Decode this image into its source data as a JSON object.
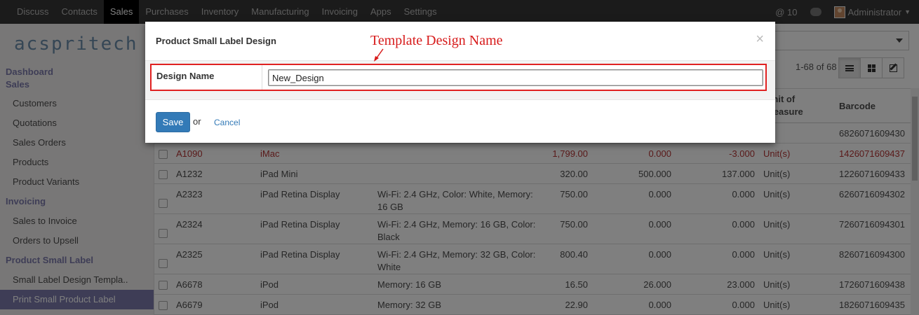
{
  "topbar": {
    "menus": [
      {
        "label": "Discuss"
      },
      {
        "label": "Contacts"
      },
      {
        "label": "Sales",
        "active": true
      },
      {
        "label": "Purchases"
      },
      {
        "label": "Inventory"
      },
      {
        "label": "Manufacturing"
      },
      {
        "label": "Invoicing"
      },
      {
        "label": "Apps"
      },
      {
        "label": "Settings"
      }
    ],
    "mentions": "@ 10",
    "user": "Administrator"
  },
  "logo": "acspritech",
  "sidebar": {
    "sections": [
      {
        "heading": "Dashboard"
      },
      {
        "heading": "Sales",
        "items": [
          "Customers",
          "Quotations",
          "Sales Orders",
          "Products",
          "Product Variants"
        ]
      },
      {
        "heading": "Invoicing",
        "items": [
          "Sales to Invoice",
          "Orders to Upsell"
        ]
      },
      {
        "heading": "Product Small Label",
        "items": [
          "Small Label Design Templa..",
          "Print Small Product Label"
        ]
      }
    ],
    "active_item": "Print Small Product Label"
  },
  "list": {
    "pager": "1-68 of 68",
    "headers": {
      "uom": "Unit of Measure",
      "barcode": "Barcode"
    },
    "rows": [
      {
        "barcode": "6826071609430"
      },
      {
        "ref": "A1090",
        "name": "iMac",
        "variant": "",
        "price": "1,799.00",
        "cost": "0.000",
        "qty": "-3.000",
        "uom": "Unit(s)",
        "barcode": "1426071609437",
        "warning": true
      },
      {
        "ref": "A1232",
        "name": "iPad Mini",
        "variant": "",
        "price": "320.00",
        "cost": "500.000",
        "qty": "137.000",
        "uom": "Unit(s)",
        "barcode": "1226071609433"
      },
      {
        "ref": "A2323",
        "name": "iPad Retina Display",
        "variant": "Wi-Fi: 2.4 GHz, Color: White, Memory: 16 GB",
        "price": "750.00",
        "cost": "0.000",
        "qty": "0.000",
        "uom": "Unit(s)",
        "barcode": "6260716094302"
      },
      {
        "ref": "A2324",
        "name": "iPad Retina Display",
        "variant": "Wi-Fi: 2.4 GHz, Memory: 16 GB, Color: Black",
        "price": "750.00",
        "cost": "0.000",
        "qty": "0.000",
        "uom": "Unit(s)",
        "barcode": "7260716094301"
      },
      {
        "ref": "A2325",
        "name": "iPad Retina Display",
        "variant": "Wi-Fi: 2.4 GHz, Memory: 32 GB, Color: White",
        "price": "800.40",
        "cost": "0.000",
        "qty": "0.000",
        "uom": "Unit(s)",
        "barcode": "8260716094300"
      },
      {
        "ref": "A6678",
        "name": "iPod",
        "variant": "Memory: 16 GB",
        "price": "16.50",
        "cost": "26.000",
        "qty": "23.000",
        "uom": "Unit(s)",
        "barcode": "1726071609438"
      },
      {
        "ref": "A6679",
        "name": "iPod",
        "variant": "Memory: 32 GB",
        "price": "22.90",
        "cost": "0.000",
        "qty": "0.000",
        "uom": "Unit(s)",
        "barcode": "1826071609435"
      }
    ]
  },
  "modal": {
    "title": "Product Small Label Design",
    "close": "×",
    "field_label": "Design Name",
    "field_value": "New_Design",
    "save_label": "Save",
    "or_text": "or",
    "cancel_label": "Cancel"
  },
  "annotation": "Template Design Name",
  "colors": {
    "topbar": "#363636",
    "accent": "#7c7bad",
    "primary": "#337ab7",
    "highlight": "#e02121"
  }
}
